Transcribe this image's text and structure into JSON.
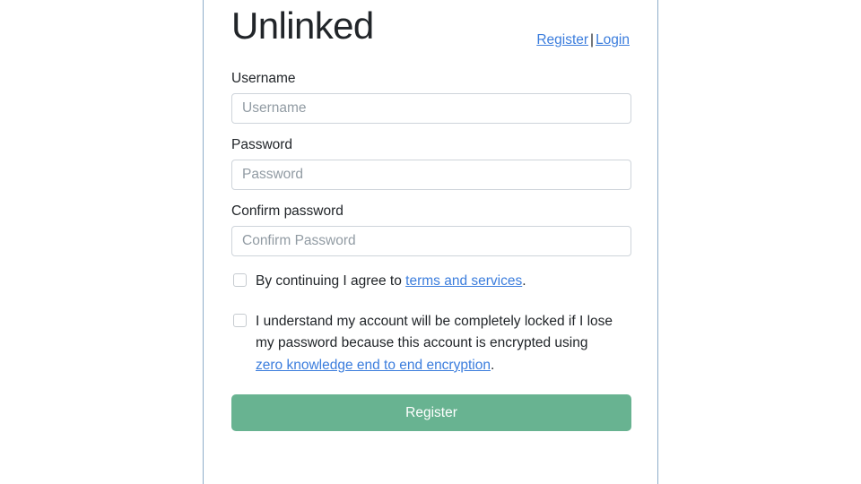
{
  "header": {
    "brand_title": "Unlinked",
    "register_link": "Register",
    "separator": "|",
    "login_link": "Login"
  },
  "form": {
    "username": {
      "label": "Username",
      "placeholder": "Username",
      "value": ""
    },
    "password": {
      "label": "Password",
      "placeholder": "Password",
      "value": ""
    },
    "confirm_password": {
      "label": "Confirm password",
      "placeholder": "Confirm Password",
      "value": ""
    },
    "terms_checkbox": {
      "text_before": "By continuing I agree to ",
      "link_text": "terms and services",
      "text_after": ".",
      "checked": false
    },
    "encryption_checkbox": {
      "text_before": "I understand my account will be completely locked if I lose my password because this account is encrypted using ",
      "link_text": "zero knowledge end to end encryption",
      "text_after": ".",
      "checked": false
    },
    "submit_label": "Register"
  },
  "colors": {
    "accent_green": "#68b391",
    "link_blue": "#3b7ddd",
    "border_blue": "#8fadc9",
    "input_border": "#ced4da",
    "text_dark": "#212529",
    "placeholder_gray": "#919ba3"
  }
}
